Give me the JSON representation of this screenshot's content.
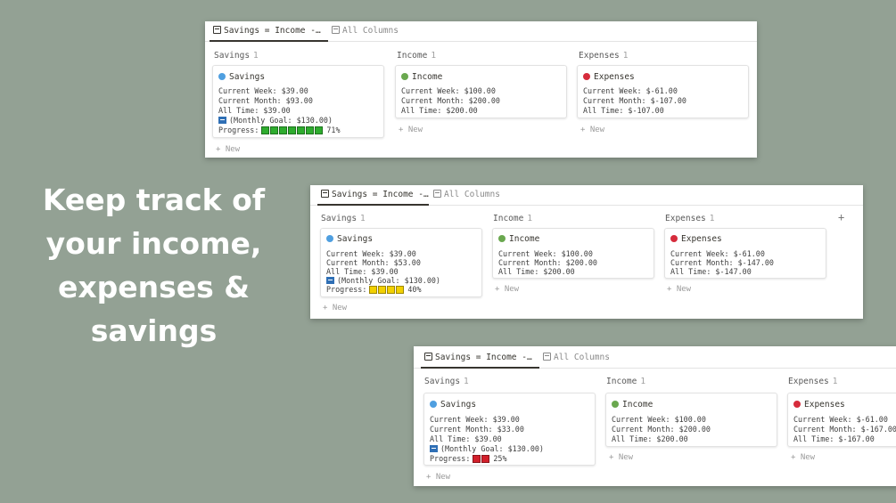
{
  "headline": [
    "Keep track of",
    "your income,",
    "expenses &",
    "savings"
  ],
  "colors": {
    "savings_dot": "#4f9fe0",
    "income_dot": "#6aa84f",
    "expenses_dot": "#d62c3c"
  },
  "panels": [
    {
      "tabs": {
        "active": "Savings = Income -…",
        "inactive": "All Columns"
      },
      "columns": [
        {
          "header": "Savings",
          "count": "1",
          "title": "Savings",
          "lines": [
            "Current Week: $39.00",
            "Current Month: $93.00",
            "All Time: $39.00"
          ],
          "goal": "(Monthly Goal: $130.00)",
          "progress_label": "Progress:",
          "progress": 0.71,
          "progress_color": "#2eac2e",
          "progress_blocks": 7,
          "progress_text": "71%",
          "new": "+ New"
        },
        {
          "header": "Income",
          "count": "1",
          "title": "Income",
          "lines": [
            "Current Week: $100.00",
            "Current Month: $200.00",
            "All Time: $200.00"
          ],
          "new": "+ New"
        },
        {
          "header": "Expenses",
          "count": "1",
          "title": "Expenses",
          "lines": [
            "Current Week: $-61.00",
            "Current Month: $-107.00",
            "All Time: $-107.00"
          ],
          "new": "+ New"
        }
      ]
    },
    {
      "tabs": {
        "active": "Savings = Income -…",
        "inactive": "All Columns"
      },
      "add_column": "+",
      "columns": [
        {
          "header": "Savings",
          "count": "1",
          "title": "Savings",
          "lines": [
            "Current Week: $39.00",
            "Current Month: $53.00",
            "All Time: $39.00"
          ],
          "goal": "(Monthly Goal: $130.00)",
          "progress_label": "Progress:",
          "progress": 0.4,
          "progress_color": "#f2d000",
          "progress_blocks": 4,
          "progress_text": "40%",
          "new": "+ New"
        },
        {
          "header": "Income",
          "count": "1",
          "title": "Income",
          "lines": [
            "Current Week: $100.00",
            "Current Month: $200.00",
            "All Time: $200.00"
          ],
          "new": "+ New"
        },
        {
          "header": "Expenses",
          "count": "1",
          "title": "Expenses",
          "lines": [
            "Current Week: $-61.00",
            "Current Month: $-147.00",
            "All Time: $-147.00"
          ],
          "new": "+ New"
        }
      ]
    },
    {
      "tabs": {
        "active": "Savings = Income -…",
        "inactive": "All Columns"
      },
      "columns": [
        {
          "header": "Savings",
          "count": "1",
          "title": "Savings",
          "lines": [
            "Current Week: $39.00",
            "Current Month: $33.00",
            "All Time: $39.00"
          ],
          "goal": "(Monthly Goal: $130.00)",
          "progress_label": "Progress:",
          "progress": 0.25,
          "progress_color": "#d21f2a",
          "progress_blocks": 2,
          "progress_text": "25%",
          "new": "+ New"
        },
        {
          "header": "Income",
          "count": "1",
          "title": "Income",
          "lines": [
            "Current Week: $100.00",
            "Current Month: $200.00",
            "All Time: $200.00"
          ],
          "new": "+ New"
        },
        {
          "header": "Expenses",
          "count": "1",
          "title": "Expenses",
          "lines": [
            "Current Week: $-61.00",
            "Current Month: $-167.00",
            "All Time: $-167.00"
          ],
          "new": "+ New"
        }
      ]
    }
  ]
}
